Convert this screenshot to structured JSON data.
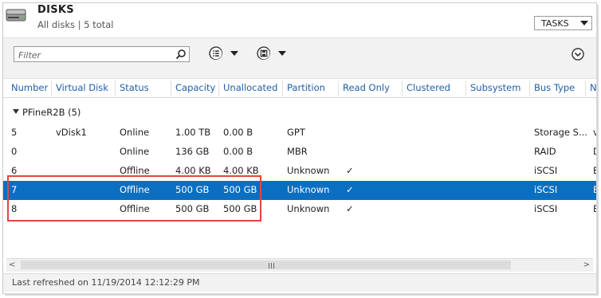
{
  "header": {
    "title": "DISKS",
    "subtitle": "All disks | 5 total",
    "tasks_label": "TASKS"
  },
  "toolbar": {
    "filter_placeholder": "Filter"
  },
  "columns": [
    "Number",
    "Virtual Disk",
    "Status",
    "Capacity",
    "Unallocated",
    "Partition",
    "Read Only",
    "Clustered",
    "Subsystem",
    "Bus Type",
    "N"
  ],
  "group": {
    "label": "PFineR2B (5)"
  },
  "rows": [
    {
      "number": "5",
      "virtual_disk": "vDisk1",
      "status": "Online",
      "capacity": "1.00 TB",
      "unallocated": "0.00 B",
      "partition": "GPT",
      "read_only": "",
      "bus_type": "Storage S...",
      "next": "v",
      "selected": false
    },
    {
      "number": "0",
      "virtual_disk": "",
      "status": "Online",
      "capacity": "136 GB",
      "unallocated": "0.00 B",
      "partition": "MBR",
      "read_only": "",
      "bus_type": "RAID",
      "next": "D",
      "selected": false
    },
    {
      "number": "6",
      "virtual_disk": "",
      "status": "Offline",
      "capacity": "4.00 KB",
      "unallocated": "4.00 KB",
      "partition": "Unknown",
      "read_only": "✓",
      "bus_type": "iSCSI",
      "next": "B",
      "selected": false
    },
    {
      "number": "7",
      "virtual_disk": "",
      "status": "Offline",
      "capacity": "500 GB",
      "unallocated": "500 GB",
      "partition": "Unknown",
      "read_only": "✓",
      "bus_type": "iSCSI",
      "next": "B",
      "selected": true
    },
    {
      "number": "8",
      "virtual_disk": "",
      "status": "Offline",
      "capacity": "500 GB",
      "unallocated": "500 GB",
      "partition": "Unknown",
      "read_only": "✓",
      "bus_type": "iSCSI",
      "next": "B",
      "selected": false
    }
  ],
  "status_bar": {
    "text": "Last refreshed on 11/19/2014 12:12:29 PM"
  },
  "icons": {
    "header": "disk-drive-icon",
    "search": "search-icon",
    "view": "list-view-icon",
    "save": "save-icon",
    "expand": "chevron-down-circle-icon"
  },
  "colors": {
    "selection": "#0b6fc1",
    "header_text": "#1f5fa8",
    "highlight_box": "#e0473f"
  }
}
